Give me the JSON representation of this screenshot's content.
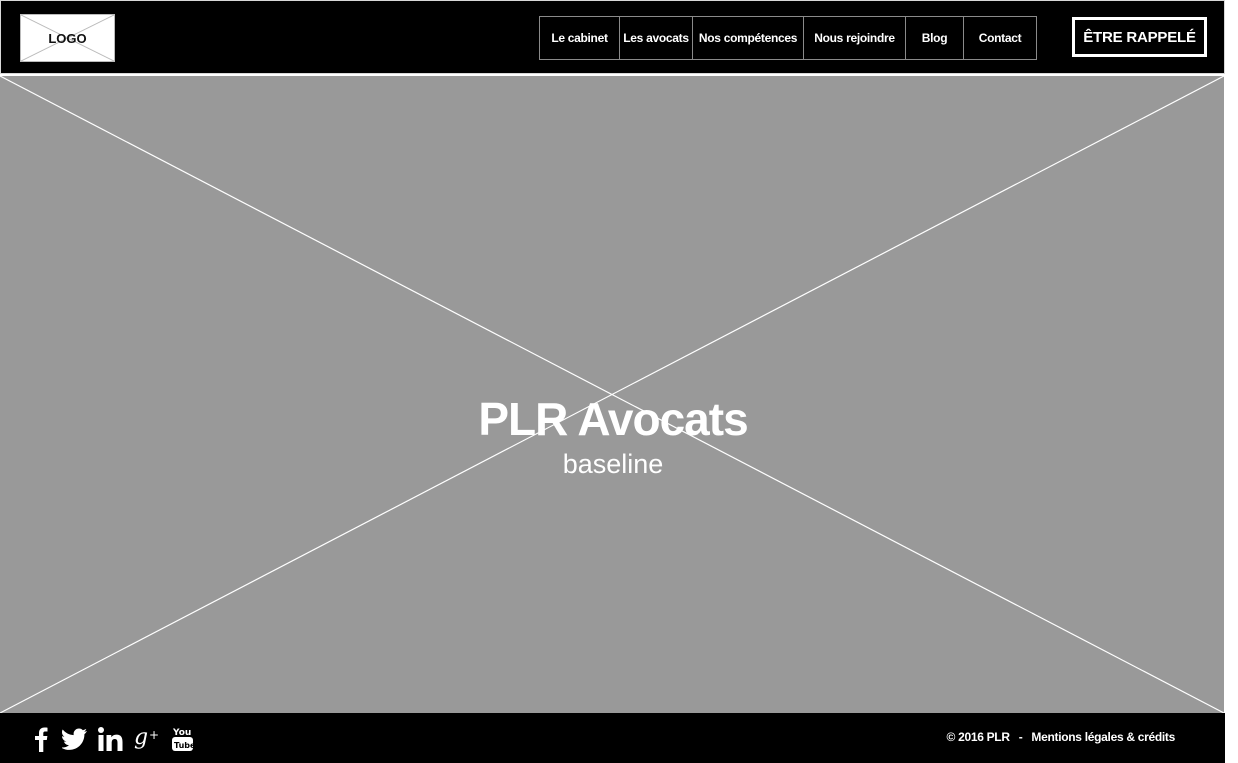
{
  "header": {
    "logo_text": "LOGO",
    "nav": [
      {
        "label": "Le cabinet"
      },
      {
        "label": "Les avocats"
      },
      {
        "label": "Nos compétences"
      },
      {
        "label": "Nous rejoindre"
      },
      {
        "label": "Blog"
      },
      {
        "label": "Contact"
      }
    ],
    "cta_label": "ÊTRE RAPPELÉ"
  },
  "hero": {
    "title": "PLR Avocats",
    "subtitle": "baseline"
  },
  "footer": {
    "social": [
      "facebook-icon",
      "twitter-icon",
      "linkedin-icon",
      "google-plus-icon",
      "youtube-icon"
    ],
    "copyright": "© 2016 PLR",
    "separator": "-",
    "legal_link": "Mentions légales & crédits"
  },
  "colors": {
    "header_bg": "#000000",
    "hero_bg": "#999999",
    "footer_bg": "#000000",
    "text": "#ffffff"
  }
}
